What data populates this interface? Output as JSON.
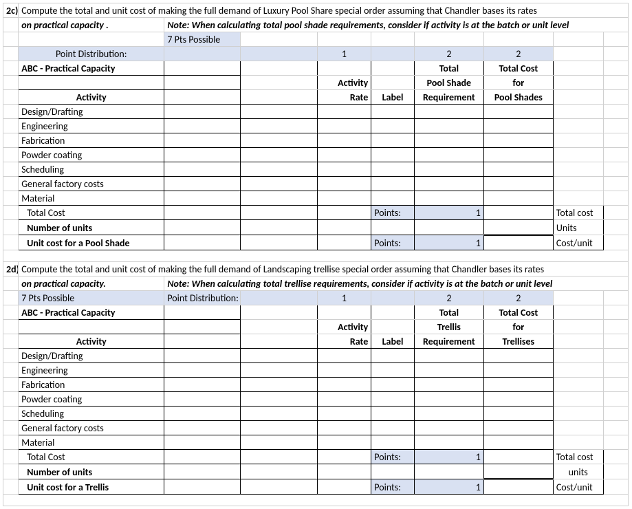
{
  "sec2c": {
    "tag": "2c)",
    "question_line1": "Compute the total and unit cost of making the full demand of Luxury Pool Share special order assuming that Chandler bases its rates",
    "question_line2a": "on practical capacity .",
    "question_line2b": "Note: When calculating total pool shade requirements, consider if activity is at the batch or unit level",
    "pts_possible": "7 Pts Possible",
    "point_dist": "Point Distribution:",
    "pd_1": "1",
    "pd_2": "2",
    "pd_3": "2",
    "title": "ABC - Practical Capacity",
    "hdr_total1": "Total",
    "hdr_totalcost1": "Total Cost",
    "hdr_activity_rate1": "Activity",
    "hdr_poolshade": "Pool Shade",
    "hdr_for": "for",
    "hdr_activity": "Activity",
    "hdr_rate": "Rate",
    "hdr_label": "Label",
    "hdr_requirement": "Requirement",
    "hdr_poolshades": "Pool Shades",
    "rows": {
      "r1": "Design/Drafting",
      "r2": "Engineering",
      "r3": "Fabrication",
      "r4": "Powder coating",
      "r5": "Scheduling",
      "r6": "General factory costs",
      "r7": "Material"
    },
    "total_cost": "Total Cost",
    "points1": "Points:",
    "points1_val": "1",
    "side_total": "Total cost",
    "num_units": "Number of units",
    "side_units": "Units",
    "unit_cost": "Unit cost for a Pool Shade",
    "points2": "Points:",
    "points2_val": "1",
    "side_costunit": "Cost/unit"
  },
  "sec2d": {
    "tag": "2d)",
    "question_line1": "Compute the total and unit cost of making the full demand of Landscaping trellise special order assuming that Chandler bases its rates",
    "question_line2a": "on practical capacity.",
    "question_line2b": "Note: When calculating total trellise requirements, consider if activity is at the batch or unit level",
    "pts_possible": "7 Pts Possible",
    "point_dist": "Point Distribution:",
    "pd_1": "1",
    "pd_2": "2",
    "pd_3": "2",
    "title": "ABC - Practical Capacity",
    "hdr_total1": "Total",
    "hdr_totalcost1": "Total Cost",
    "hdr_activity_rate1": "Activity",
    "hdr_trellis": "Trellis",
    "hdr_for": "for",
    "hdr_activity": "Activity",
    "hdr_rate": "Rate",
    "hdr_label": "Label",
    "hdr_requirement": "Requirement",
    "hdr_trellises": "Trellises",
    "rows": {
      "r1": "Design/Drafting",
      "r2": "Engineering",
      "r3": "Fabrication",
      "r4": "Powder coating",
      "r5": "Scheduling",
      "r6": "General factory costs",
      "r7": "Material"
    },
    "total_cost": "Total Cost",
    "points1": "Points:",
    "points1_val": "1",
    "side_total": "Total cost",
    "num_units": "Number of units",
    "side_units": "units",
    "unit_cost": "Unit cost for a Trellis",
    "points2": "Points:",
    "points2_val": "1",
    "side_costunit": "Cost/unit"
  }
}
